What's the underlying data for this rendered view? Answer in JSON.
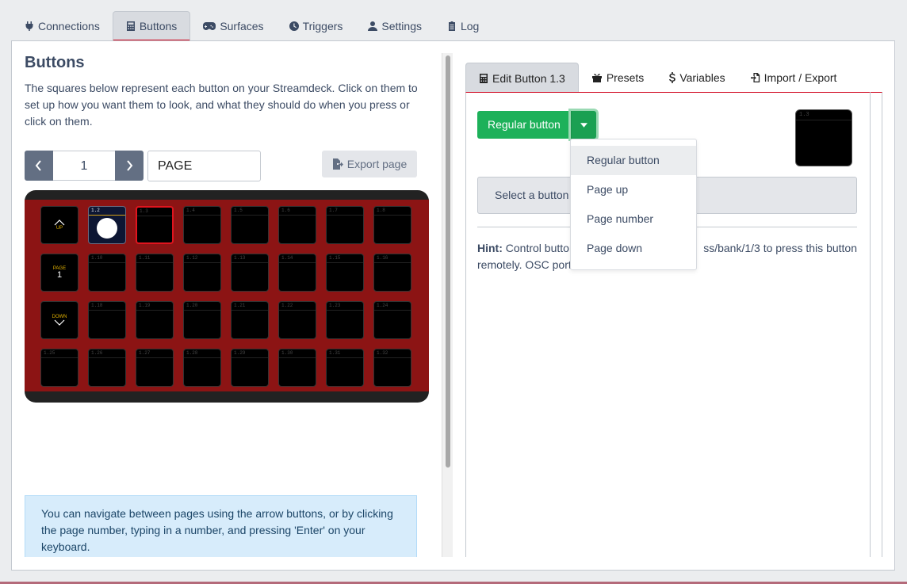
{
  "topnav": {
    "tabs": [
      {
        "label": "Connections",
        "icon": "plug-icon"
      },
      {
        "label": "Buttons",
        "icon": "calculator-icon"
      },
      {
        "label": "Surfaces",
        "icon": "gamepad-icon"
      },
      {
        "label": "Triggers",
        "icon": "clock-icon"
      },
      {
        "label": "Settings",
        "icon": "user-cog-icon"
      },
      {
        "label": "Log",
        "icon": "clipboard-icon"
      }
    ],
    "active": "Buttons"
  },
  "left": {
    "title": "Buttons",
    "description": "The squares below represent each button on your Streamdeck. Click on them to set up how you want them to look, and what they should do when you press or click on them.",
    "page_number": "1",
    "page_name": "PAGE",
    "export_label": "Export page",
    "info": "You can navigate between pages using the arrow buttons, or by clicking the page number, typing in a number, and pressing 'Enter' on your keyboard."
  },
  "grid": {
    "nav_up": {
      "small": "UP"
    },
    "nav_page": {
      "small": "PAGE",
      "big": "1"
    },
    "nav_down": {
      "small": "DOWN"
    },
    "keys": [
      [
        "1.2",
        "1.3",
        "1.4",
        "1.5",
        "1.6",
        "1.7",
        "1.8"
      ],
      [
        "1.10",
        "1.11",
        "1.12",
        "1.13",
        "1.14",
        "1.15",
        "1.16"
      ],
      [
        "1.18",
        "1.19",
        "1.20",
        "1.21",
        "1.22",
        "1.23",
        "1.24"
      ],
      [
        "1.25",
        "1.26",
        "1.27",
        "1.28",
        "1.29",
        "1.30",
        "1.31",
        "1.32"
      ]
    ]
  },
  "right": {
    "tabs": [
      {
        "label": "Edit Button 1.3",
        "icon": "calculator-icon"
      },
      {
        "label": "Presets",
        "icon": "gift-icon"
      },
      {
        "label": "Variables",
        "icon": "dollar-icon"
      },
      {
        "label": "Import / Export",
        "icon": "file-import-icon"
      }
    ],
    "type_button": "Regular button",
    "preview_label": "1.3",
    "select_text": "Select a button",
    "hint_label": "Hint:",
    "hint_line1_left": "Control button",
    "hint_line1_right": "ss/bank/1/3 to press this button",
    "hint_line2": "remotely. OSC port",
    "dropdown": [
      "Regular button",
      "Page up",
      "Page number",
      "Page down"
    ]
  }
}
